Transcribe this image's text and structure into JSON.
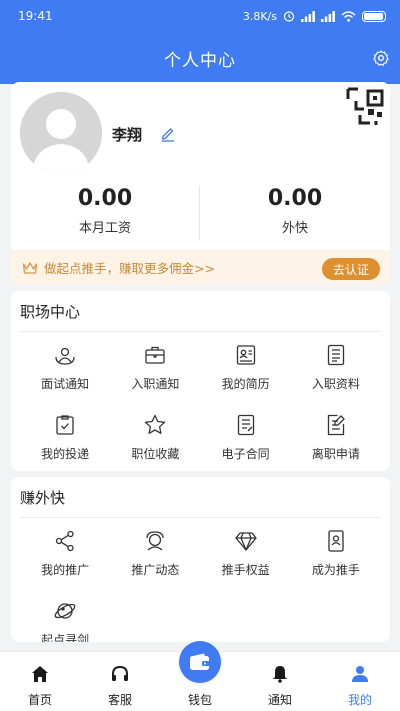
{
  "status": {
    "time": "19:41",
    "network": "3.8K/s"
  },
  "header": {
    "title": "个人中心"
  },
  "profile": {
    "name": "李翔",
    "salary_value": "0.00",
    "salary_label": "本月工资",
    "side_value": "0.00",
    "side_label": "外快"
  },
  "promo": {
    "text": "做起点推手，赚取更多佣金>>",
    "button": "去认证"
  },
  "workplace": {
    "title": "职场中心",
    "items": [
      {
        "label": "面试通知",
        "icon": "interview-icon"
      },
      {
        "label": "入职通知",
        "icon": "briefcase-icon"
      },
      {
        "label": "我的简历",
        "icon": "resume-icon"
      },
      {
        "label": "入职资料",
        "icon": "document-icon"
      },
      {
        "label": "我的投递",
        "icon": "delivery-icon"
      },
      {
        "label": "职位收藏",
        "icon": "star-icon"
      },
      {
        "label": "电子合同",
        "icon": "contract-icon"
      },
      {
        "label": "离职申请",
        "icon": "resign-icon"
      }
    ]
  },
  "extra": {
    "title": "赚外快",
    "items": [
      {
        "label": "我的推广",
        "icon": "share-icon"
      },
      {
        "label": "推广动态",
        "icon": "dynamic-icon"
      },
      {
        "label": "推手权益",
        "icon": "diamond-icon"
      },
      {
        "label": "成为推手",
        "icon": "phone-user-icon"
      },
      {
        "label": "起点寻剑",
        "icon": "planet-icon"
      }
    ]
  },
  "tabs": [
    {
      "label": "首页"
    },
    {
      "label": "客服"
    },
    {
      "label": "钱包"
    },
    {
      "label": "通知"
    },
    {
      "label": "我的"
    }
  ],
  "colors": {
    "brand": "#3f7cf4",
    "promo_bg": "#fdf3e6",
    "promo_text": "#c98a3a",
    "promo_button": "#de8f2e"
  }
}
